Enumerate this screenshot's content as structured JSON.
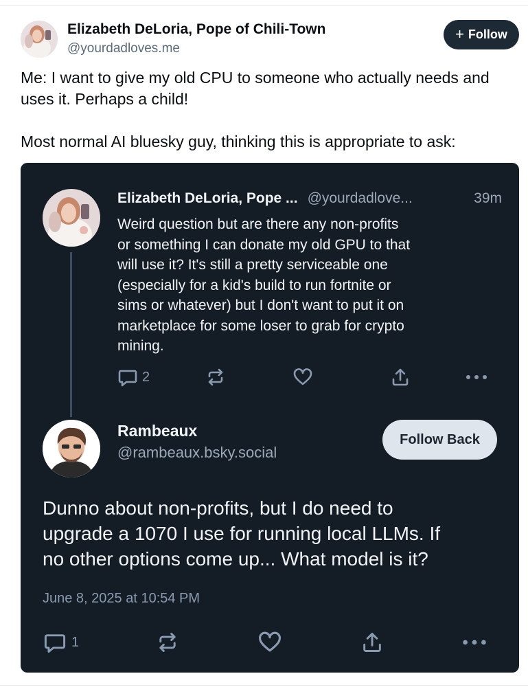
{
  "outer_post": {
    "author_name": "Elizabeth DeLoria, Pope of Chili-Town",
    "handle": "@yourdadloves.me",
    "follow_label": "Follow",
    "follow_icon": "plus-icon",
    "text": "Me: I want to give my old CPU to someone who actually needs and uses it. Perhaps a child!\n\nMost normal AI bluesky guy, thinking this is appropriate to ask:"
  },
  "embedded": {
    "background_color": "#141c26",
    "parent_post": {
      "author_name": "Elizabeth DeLoria, Pope ...",
      "handle": "@yourdadlove...",
      "time": "39m",
      "text": "Weird question but are there any non-profits\nor something I can donate my old GPU to that\nwill use it? It's still a pretty serviceable one\n(especially for a kid's build to run fortnite or\nsims or whatever) but I don't want to put it on\nmarketplace for some loser to grab for crypto\nmining.",
      "reply_count": "2",
      "action_icons": [
        "reply-icon",
        "repost-icon",
        "like-icon",
        "share-icon",
        "more-icon"
      ]
    },
    "reply_post": {
      "author_name": "Rambeaux",
      "handle": "@rambeaux.bsky.social",
      "follow_back_label": "Follow Back",
      "text": "Dunno about non-profits, but I do need to\nupgrade a 1070 I use for running local LLMs. If\nno other options come up... What model is it?",
      "timestamp": "June 8, 2025 at 10:54 PM",
      "reply_count": "1",
      "action_icons": [
        "reply-icon",
        "repost-icon",
        "like-icon",
        "share-icon",
        "more-icon"
      ]
    }
  }
}
